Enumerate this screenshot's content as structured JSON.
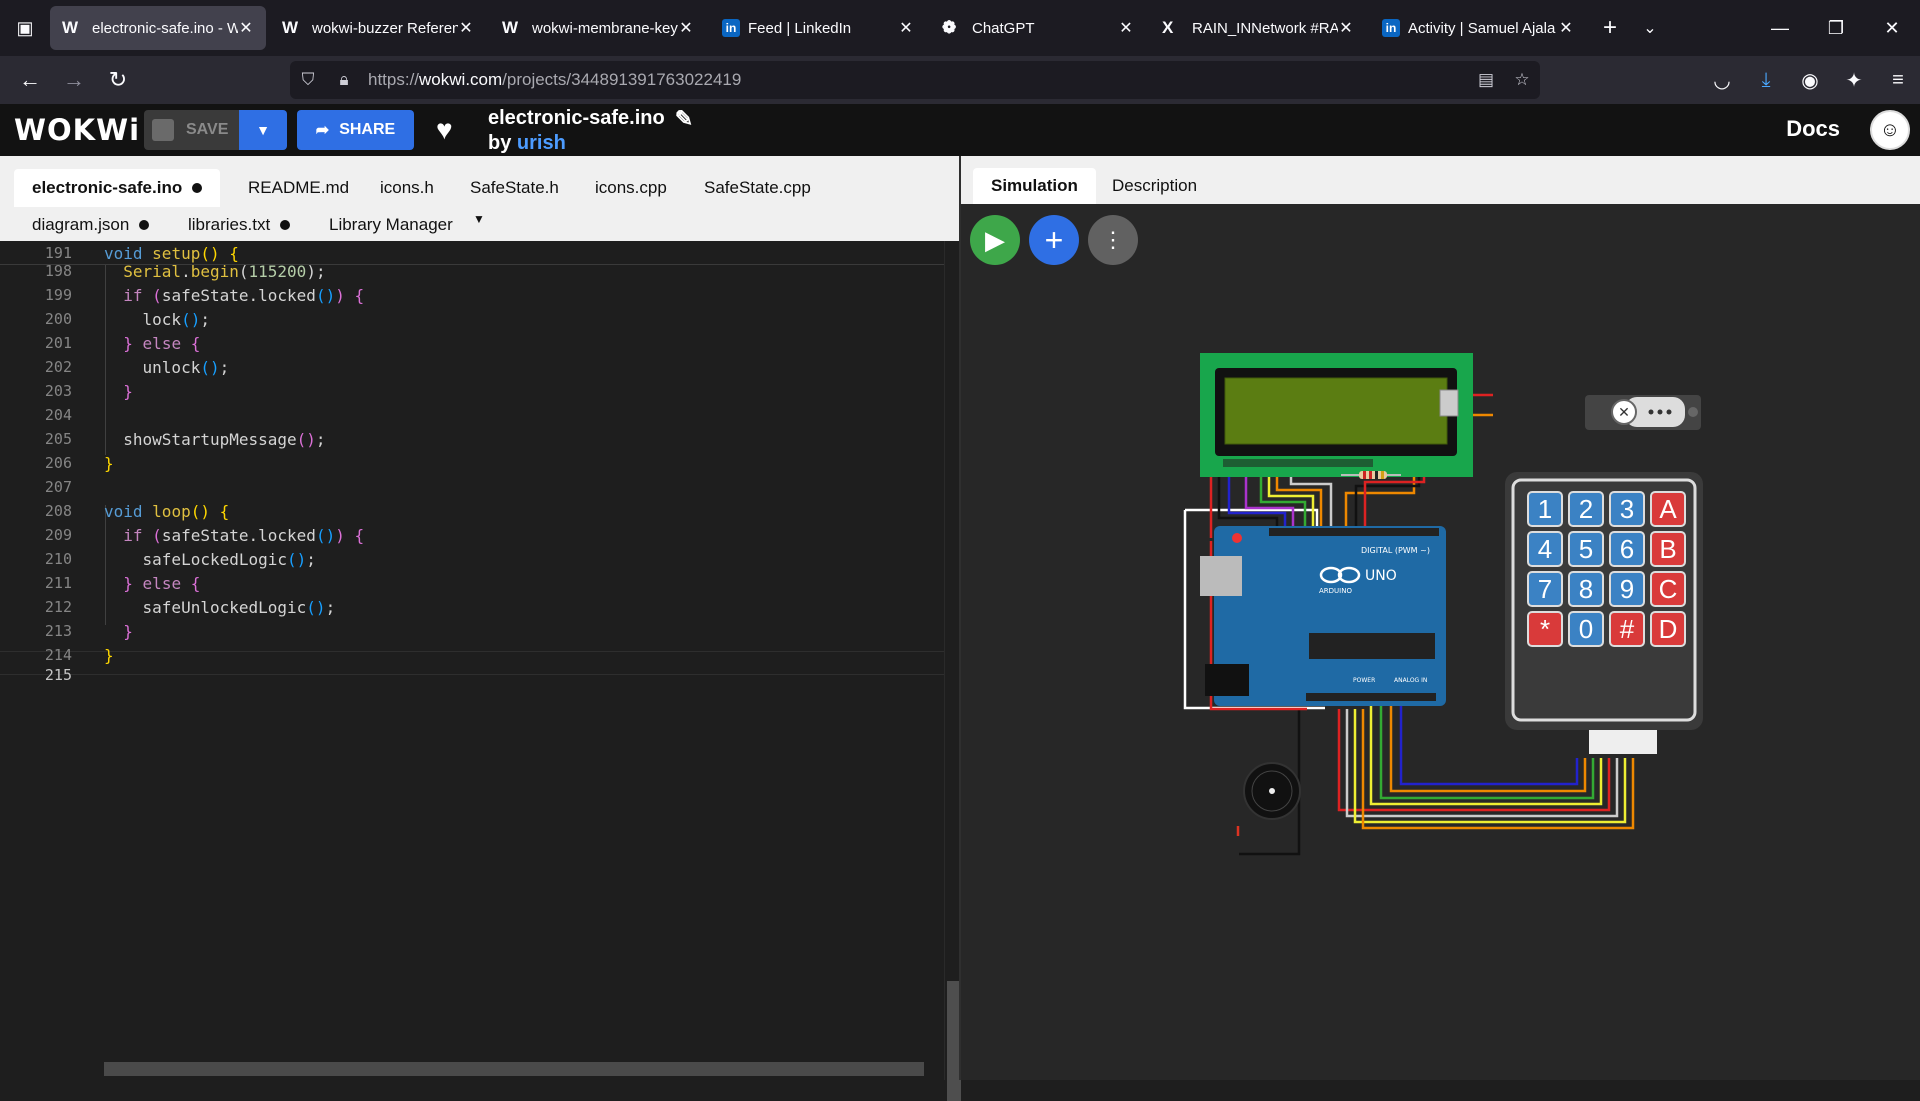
{
  "browser": {
    "tabs": [
      {
        "title": "electronic-safe.ino - W",
        "favicon": "W",
        "active": true
      },
      {
        "title": "wokwi-buzzer Referen",
        "favicon": "W"
      },
      {
        "title": "wokwi-membrane-key",
        "favicon": "W"
      },
      {
        "title": "Feed | LinkedIn",
        "favicon": "in"
      },
      {
        "title": "ChatGPT",
        "favicon": "chatgpt-icon"
      },
      {
        "title": "RAIN_INNetwork #RAI",
        "favicon": "X"
      },
      {
        "title": "Activity | Samuel Ajala",
        "favicon": "in"
      }
    ],
    "url_prefix": "https://",
    "url_host": "wokwi.com",
    "url_path": "/projects/344891391763022419"
  },
  "header": {
    "logo": "WOKWi",
    "save_label": "SAVE",
    "share_label": "SHARE",
    "project_name": "electronic-safe.ino",
    "by_label": "by",
    "author": "urish",
    "docs_label": "Docs"
  },
  "editor": {
    "file_tabs_row1": [
      {
        "label": "electronic-safe.ino",
        "modified": true,
        "active": true
      },
      {
        "label": "README.md"
      },
      {
        "label": "icons.h"
      },
      {
        "label": "SafeState.h"
      },
      {
        "label": "icons.cpp"
      },
      {
        "label": "SafeState.cpp"
      }
    ],
    "file_tabs_row2": [
      {
        "label": "diagram.json",
        "modified": true
      },
      {
        "label": "libraries.txt",
        "modified": true
      },
      {
        "label": "Library Manager"
      }
    ],
    "line_numbers": [
      "191",
      "198",
      "199",
      "200",
      "201",
      "202",
      "203",
      "204",
      "205",
      "206",
      "207",
      "208",
      "209",
      "210",
      "211",
      "212",
      "213",
      "214",
      "215"
    ],
    "code_lines": [
      "void setup() {",
      "  Serial.begin(115200);",
      "  if (safeState.locked()) {",
      "    lock();",
      "  } else {",
      "    unlock();",
      "  }",
      "",
      "  showStartupMessage();",
      "}",
      "",
      "void loop() {",
      "  if (safeState.locked()) {",
      "    safeLockedLogic();",
      "  } else {",
      "    safeUnlockedLogic();",
      "  }",
      "}",
      ""
    ]
  },
  "simulation": {
    "tabs": [
      {
        "label": "Simulation",
        "active": true
      },
      {
        "label": "Description"
      }
    ],
    "keypad_keys": [
      "1",
      "2",
      "3",
      "A",
      "4",
      "5",
      "6",
      "B",
      "7",
      "8",
      "9",
      "C",
      "*",
      "0",
      "#",
      "D"
    ],
    "arduino_label": "UNO",
    "arduino_brand": "ARDUINO",
    "digital_label": "DIGITAL (PWM ~)",
    "power_label": "POWER",
    "analog_label": "ANALOG IN",
    "colors": {
      "keypad_blue": "#3b82c4",
      "keypad_red": "#d93a3a",
      "lcd_green": "#6e9a1a",
      "arduino_blue": "#1f6aa5",
      "play_green": "#3ea74a",
      "wokwi_blue": "#2f6fe4"
    }
  }
}
